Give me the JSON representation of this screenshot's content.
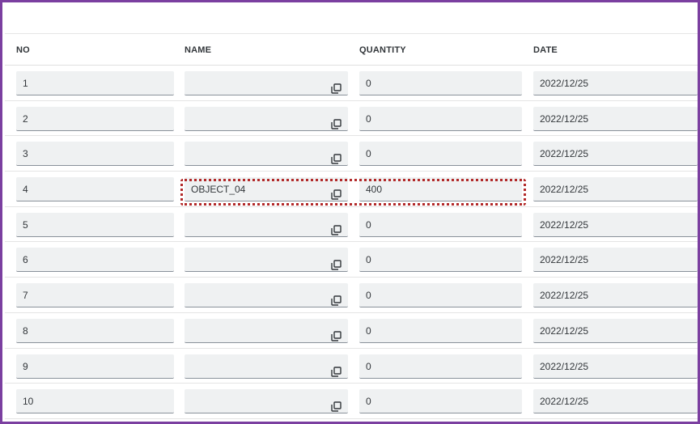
{
  "table": {
    "columns": [
      {
        "key": "no",
        "label": "NO"
      },
      {
        "key": "name",
        "label": "NAME"
      },
      {
        "key": "quantity",
        "label": "QUANTITY"
      },
      {
        "key": "date",
        "label": "DATE"
      }
    ],
    "rows": [
      {
        "no": "1",
        "name": "",
        "quantity": "0",
        "date": "2022/12/25"
      },
      {
        "no": "2",
        "name": "",
        "quantity": "0",
        "date": "2022/12/25"
      },
      {
        "no": "3",
        "name": "",
        "quantity": "0",
        "date": "2022/12/25"
      },
      {
        "no": "4",
        "name": "OBJECT_04",
        "quantity": "400",
        "date": "2022/12/25"
      },
      {
        "no": "5",
        "name": "",
        "quantity": "0",
        "date": "2022/12/25"
      },
      {
        "no": "6",
        "name": "",
        "quantity": "0",
        "date": "2022/12/25"
      },
      {
        "no": "7",
        "name": "",
        "quantity": "0",
        "date": "2022/12/25"
      },
      {
        "no": "8",
        "name": "",
        "quantity": "0",
        "date": "2022/12/25"
      },
      {
        "no": "9",
        "name": "",
        "quantity": "0",
        "date": "2022/12/25"
      },
      {
        "no": "10",
        "name": "",
        "quantity": "0",
        "date": "2022/12/25"
      }
    ],
    "value_help_icon": "value-help-icon",
    "highlighted_row": "4"
  },
  "colors": {
    "frame_border": "#7b3fa0",
    "field_background": "#eff1f2",
    "field_underline": "#89919a",
    "highlight_border": "#b22a2a",
    "text": "#32363a"
  }
}
